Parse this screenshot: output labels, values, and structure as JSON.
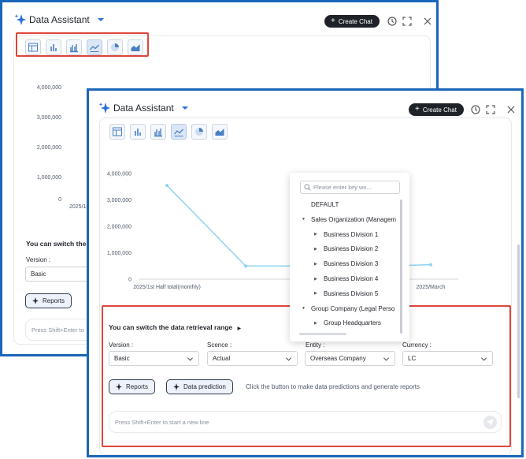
{
  "app": {
    "title": "Data Assistant",
    "create_chat": "Create Chat"
  },
  "toolbar": {
    "icons": [
      "table-icon",
      "bar-chart-icon",
      "grouped-bar-chart-icon",
      "line-chart-icon",
      "pie-chart-icon",
      "area-chart-icon"
    ],
    "selected": "line-chart-icon"
  },
  "back_panel": {
    "y_ticks": [
      "4,000,000",
      "3,000,000",
      "2,000,000",
      "1,000,000",
      "0"
    ],
    "x_first": "2025/1s",
    "switch_title": "You can switch the d",
    "version_label": "Version :",
    "version_value": "Basic",
    "reports": "Reports",
    "input_placeholder": "Press Shift+Enter to"
  },
  "front_panel": {
    "switch_title": "You can switch the data retrieval range",
    "filters": [
      {
        "label": "Version :",
        "value": "Basic"
      },
      {
        "label": "Scence :",
        "value": "Actual"
      },
      {
        "label": "Entity :",
        "value": "Overseas Company"
      },
      {
        "label": "Currency :",
        "value": "LC"
      }
    ],
    "reports": "Reports",
    "data_prediction": "Data prediction",
    "hint": "Click the button to make data predictions and generate reports",
    "input_placeholder": "Press Shift+Enter to start a new line"
  },
  "chart_data": {
    "type": "line",
    "categories": [
      "2025/1st Half total(monthly)",
      "",
      "",
      "",
      "2025/March"
    ],
    "series": [
      {
        "values": [
          3550000,
          500000,
          500000,
          500000,
          550000
        ],
        "color": "#8ed3f0"
      }
    ],
    "ylim": [
      0,
      4000000
    ],
    "y_ticks": [
      "4,000,000",
      "3,000,000",
      "2,000,000",
      "1,000,000",
      "0"
    ],
    "grid": false
  },
  "dropdown": {
    "search_placeholder": "Please enter key wo...",
    "items": [
      {
        "label": "DEFAULT",
        "level": 0,
        "arrow": ""
      },
      {
        "label": "Sales Organization (Managem",
        "level": 0,
        "arrow": "expanded"
      },
      {
        "label": "Business Division 1",
        "level": 1,
        "arrow": "collapsed"
      },
      {
        "label": "Business Division 2",
        "level": 1,
        "arrow": "collapsed"
      },
      {
        "label": "Business Division 3",
        "level": 1,
        "arrow": "collapsed"
      },
      {
        "label": "Business Division 4",
        "level": 1,
        "arrow": "collapsed"
      },
      {
        "label": "Business Division 5",
        "level": 1,
        "arrow": "collapsed"
      },
      {
        "label": "Group Company (Legal Perso",
        "level": 0,
        "arrow": "expanded"
      },
      {
        "label": "Group Headquarters",
        "level": 1,
        "arrow": "collapsed"
      }
    ]
  },
  "colors": {
    "accent": "#1a66b8",
    "highlight": "#e0453a",
    "line": "#8ed3f0"
  }
}
